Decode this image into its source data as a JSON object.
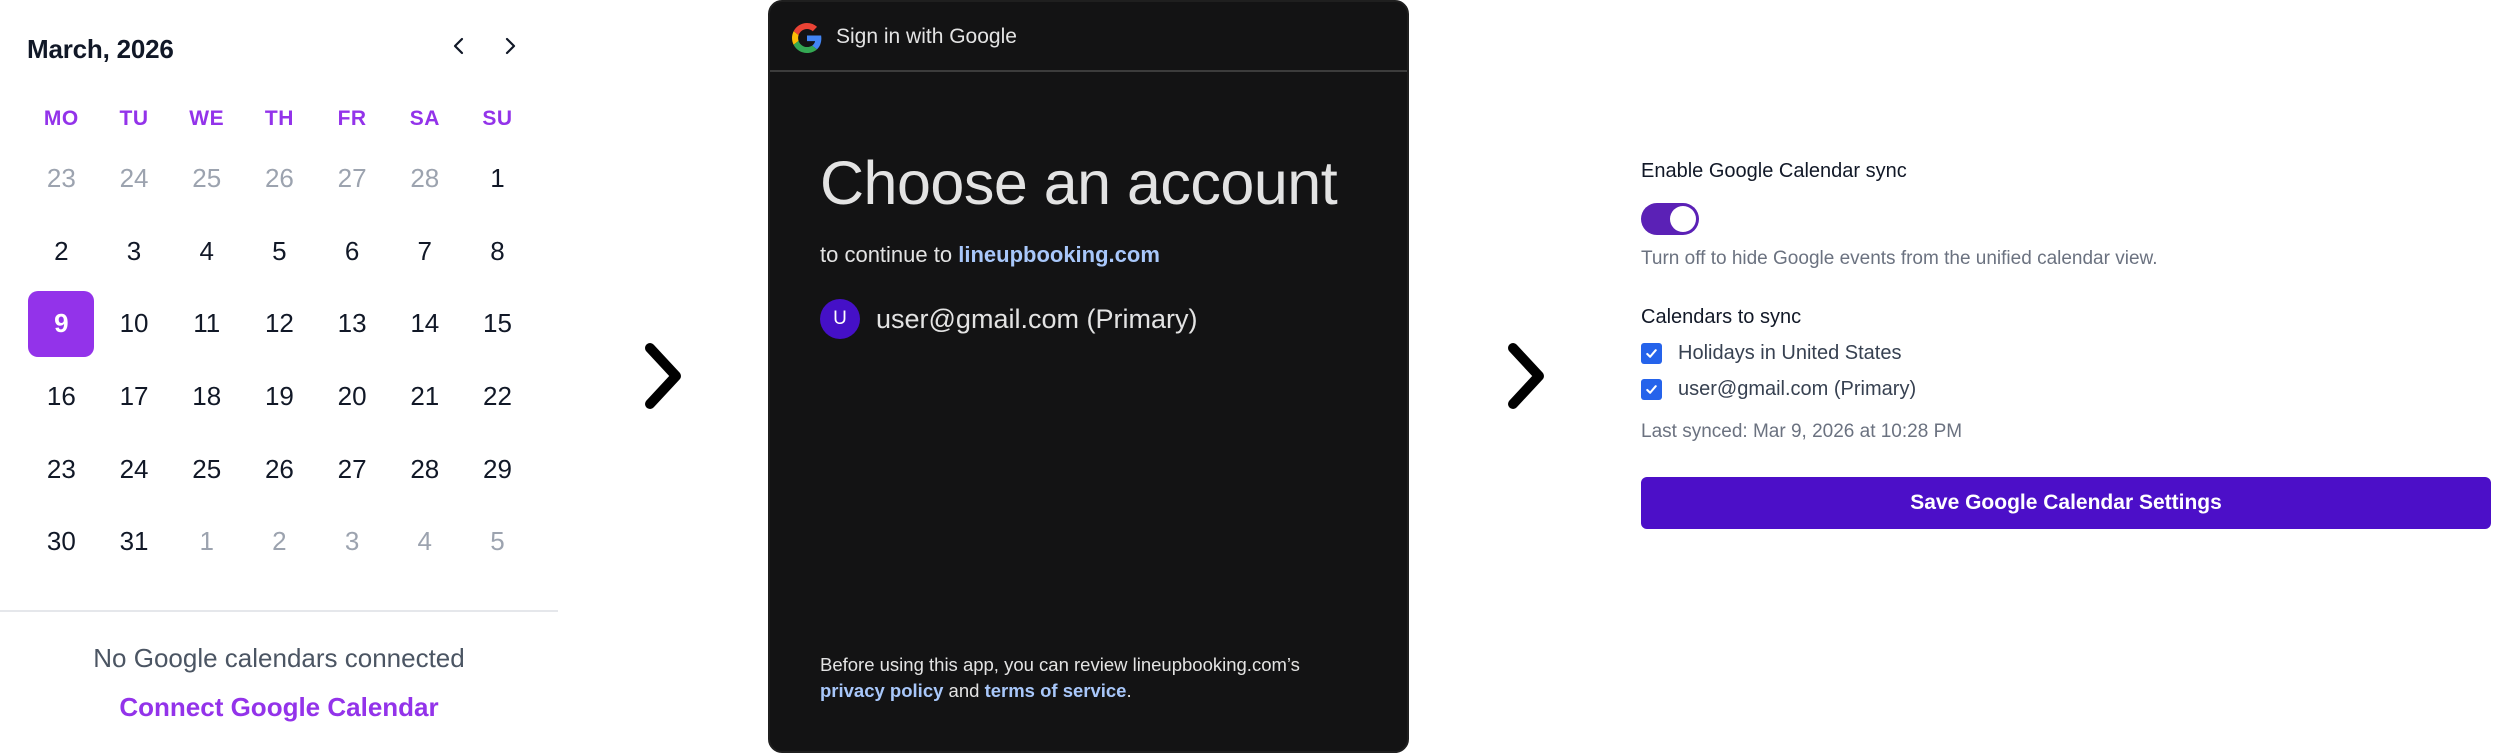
{
  "calendar": {
    "title": "March, 2026",
    "weekdays": [
      "MO",
      "TU",
      "WE",
      "TH",
      "FR",
      "SA",
      "SU"
    ],
    "weeks": [
      [
        {
          "d": "23",
          "m": true
        },
        {
          "d": "24",
          "m": true
        },
        {
          "d": "25",
          "m": true
        },
        {
          "d": "26",
          "m": true
        },
        {
          "d": "27",
          "m": true
        },
        {
          "d": "28",
          "m": true
        },
        {
          "d": "1",
          "m": false
        }
      ],
      [
        {
          "d": "2",
          "m": false
        },
        {
          "d": "3",
          "m": false
        },
        {
          "d": "4",
          "m": false
        },
        {
          "d": "5",
          "m": false
        },
        {
          "d": "6",
          "m": false
        },
        {
          "d": "7",
          "m": false
        },
        {
          "d": "8",
          "m": false
        }
      ],
      [
        {
          "d": "9",
          "m": false,
          "selected": true
        },
        {
          "d": "10",
          "m": false
        },
        {
          "d": "11",
          "m": false
        },
        {
          "d": "12",
          "m": false
        },
        {
          "d": "13",
          "m": false
        },
        {
          "d": "14",
          "m": false
        },
        {
          "d": "15",
          "m": false
        }
      ],
      [
        {
          "d": "16",
          "m": false
        },
        {
          "d": "17",
          "m": false
        },
        {
          "d": "18",
          "m": false
        },
        {
          "d": "19",
          "m": false
        },
        {
          "d": "20",
          "m": false
        },
        {
          "d": "21",
          "m": false
        },
        {
          "d": "22",
          "m": false
        }
      ],
      [
        {
          "d": "23",
          "m": false
        },
        {
          "d": "24",
          "m": false
        },
        {
          "d": "25",
          "m": false
        },
        {
          "d": "26",
          "m": false
        },
        {
          "d": "27",
          "m": false
        },
        {
          "d": "28",
          "m": false
        },
        {
          "d": "29",
          "m": false
        }
      ],
      [
        {
          "d": "30",
          "m": false
        },
        {
          "d": "31",
          "m": false
        },
        {
          "d": "1",
          "m": true
        },
        {
          "d": "2",
          "m": true
        },
        {
          "d": "3",
          "m": true
        },
        {
          "d": "4",
          "m": true
        },
        {
          "d": "5",
          "m": true
        }
      ]
    ],
    "prev_icon": "chevron-left-icon",
    "next_icon": "chevron-right-icon",
    "empty_text": "No Google calendars connected",
    "connect_label": "Connect Google Calendar",
    "accent_color": "#9333ea"
  },
  "google": {
    "header_text": "Sign in with Google",
    "logo_icon": "google-g-icon",
    "heading": "Choose an account",
    "continue_prefix": "to continue to",
    "continue_domain": "lineupbooking.com",
    "account": {
      "avatar_letter": "U",
      "email": "user@gmail.com (Primary)"
    },
    "footer": {
      "prefix": "Before using this app, you can review lineupbooking.com’s",
      "privacy_label": "privacy policy",
      "and": "and",
      "terms_label": "terms of service",
      "suffix": "."
    }
  },
  "arrows": {
    "icon": "chevron-right-icon"
  },
  "settings": {
    "sync_label": "Enable Google Calendar sync",
    "sync_enabled": true,
    "sync_help": "Turn off to hide Google events from the unified calendar view.",
    "calendars_label": "Calendars to sync",
    "calendars": [
      {
        "label": "Holidays in United States",
        "checked": true
      },
      {
        "label": "user@gmail.com (Primary)",
        "checked": true
      }
    ],
    "last_synced": "Last synced: Mar 9, 2026 at 10:28 PM",
    "save_label": "Save Google Calendar Settings",
    "primary_color": "#4c0fc8"
  }
}
